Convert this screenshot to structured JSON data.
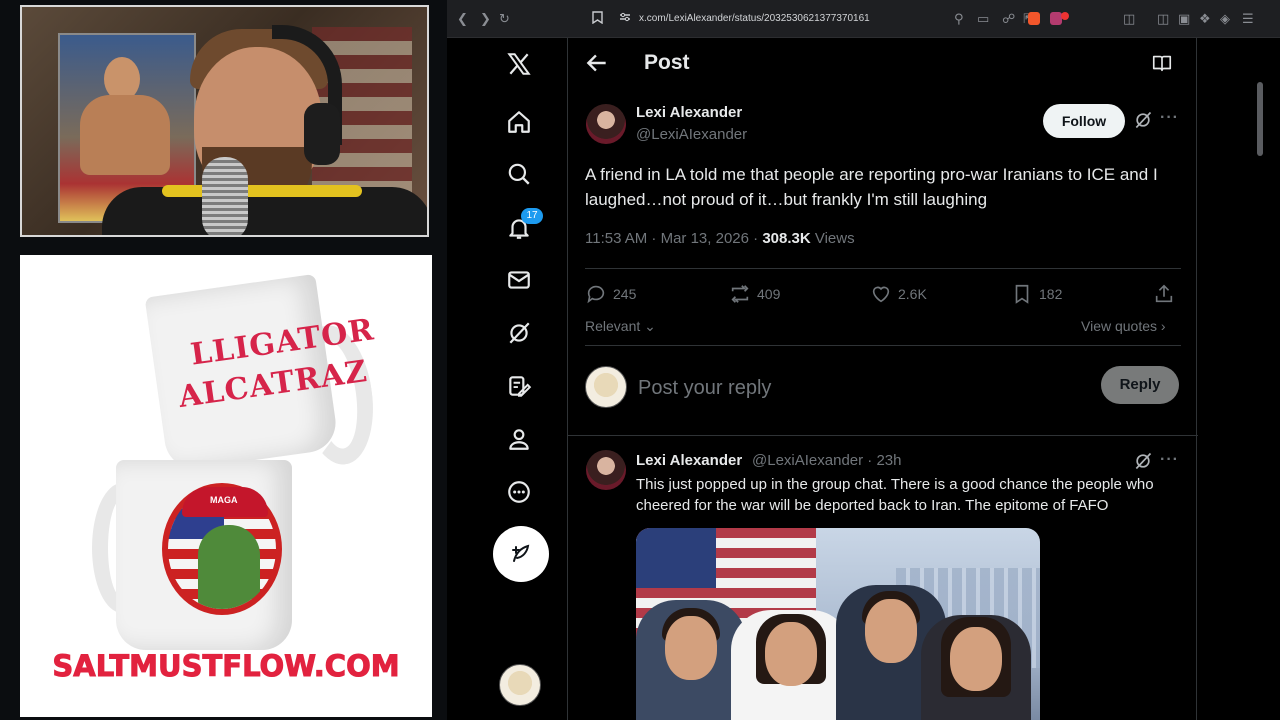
{
  "overlay": {
    "merch_url": "SALTMUSTFLOW.COM",
    "mug_text_line1": "LLIGATOR",
    "mug_text_line2": "ALCATRAZ",
    "mug_hat_text": "MAGA"
  },
  "browser": {
    "url": "x.com/LexiAlexander/status/2032530621377370161"
  },
  "nav": {
    "notifications_badge": "17",
    "icons": [
      "x-logo-icon",
      "home-icon",
      "search-icon",
      "bell-icon",
      "mail-icon",
      "grok-icon",
      "edit-icon",
      "profile-icon",
      "more-circle-icon",
      "compose-icon"
    ]
  },
  "header": {
    "title": "Post"
  },
  "post": {
    "author_name": "Lexi Alexander",
    "author_handle": "@LexiAIexander",
    "follow_label": "Follow",
    "text": "A friend in LA told me that people are reporting pro-war Iranians to ICE and I laughed…not proud of it…but frankly I'm still laughing",
    "time": "11:53 AM · Mar 13, 2026 · ",
    "views_count": "308.3K",
    "views_label": " Views",
    "replies": "245",
    "reposts": "409",
    "likes": "2.6K",
    "bookmarks": "182",
    "sort_label": "Relevant",
    "view_quotes_label": "View quotes"
  },
  "reply": {
    "placeholder": "Post your reply",
    "button_label": "Reply"
  },
  "thread": {
    "author_name": "Lexi Alexander",
    "meta": "@LexiAIexander · 23h",
    "text": "This just popped up in the group chat. There is a good chance the people who cheered for the war will be deported back to Iran. The epitome of FAFO"
  },
  "colors": {
    "accent": "#1d9bf0",
    "merch_red": "#e2223f",
    "text_secondary": "#71767b"
  }
}
